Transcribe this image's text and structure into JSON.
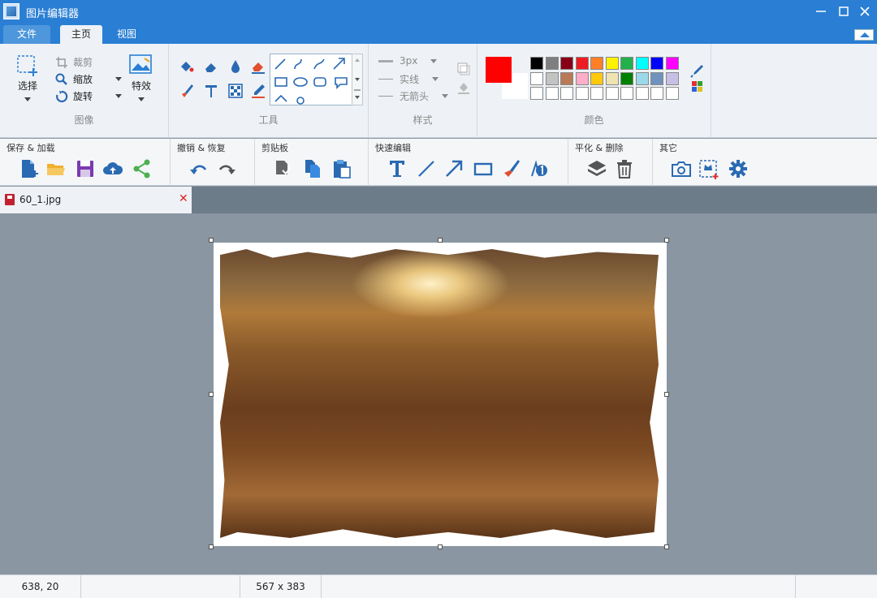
{
  "titlebar": {
    "title": "图片编辑器"
  },
  "tabs": [
    {
      "label": "文件"
    },
    {
      "label": "主页"
    },
    {
      "label": "视图"
    }
  ],
  "ribbon": {
    "image_group": {
      "label": "图像",
      "select_label": "选择",
      "crop_label": "裁剪",
      "zoom_label": "缩放",
      "rotate_label": "旋转",
      "effects_label": "特效"
    },
    "tools_group": {
      "label": "工具"
    },
    "style_group": {
      "label": "样式",
      "width_value": "3px",
      "line_value": "实线",
      "arrow_value": "无箭头"
    },
    "color_group": {
      "label": "颜色",
      "primary": "#ff0000",
      "secondary": "#ffffff",
      "palette_row1": [
        "#000000",
        "#7f7f7f",
        "#880015",
        "#ed1c24",
        "#ff7f27",
        "#fff200",
        "#22b14c",
        "#00ffff",
        "#0000ff",
        "#ff00ff"
      ],
      "palette_row2": [
        "#ffffff",
        "#c3c3c3",
        "#b97a57",
        "#ffaec9",
        "#ffc90e",
        "#efe4b0",
        "#008000",
        "#99d9ea",
        "#7092be",
        "#c8bfe7"
      ],
      "palette_row3": [
        "#ffffff",
        "#ffffff",
        "#ffffff",
        "#ffffff",
        "#ffffff",
        "#ffffff",
        "#ffffff",
        "#ffffff",
        "#ffffff",
        "#ffffff"
      ]
    }
  },
  "quickbar": {
    "save_load": "保存 & 加载",
    "undo_redo": "撤销 & 恢复",
    "clipboard": "剪贴板",
    "quick_edit": "快速编辑",
    "flatten_delete": "平化 & 删除",
    "other": "其它"
  },
  "document": {
    "filename": "60_1.jpg",
    "close_glyph": "✕"
  },
  "status": {
    "cursor_position": "638, 20",
    "image_size": "567 x 383"
  }
}
